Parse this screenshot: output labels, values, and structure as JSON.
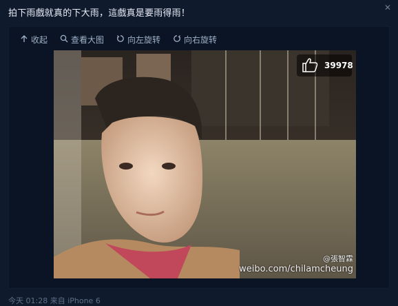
{
  "post": {
    "text": "拍下雨戲就真的下大雨，這戲真是要雨得雨！",
    "close_icon": "✕"
  },
  "toolbar": {
    "collapse": "收起",
    "view_large": "查看大图",
    "rotate_left": "向左旋转",
    "rotate_right": "向右旋转"
  },
  "photo": {
    "like_count": "39978",
    "watermark_handle": "@張智霖",
    "watermark_url": "weibo.com/chilamcheung"
  },
  "footer": {
    "meta": "今天 01:28 来自 iPhone 6"
  },
  "colors": {
    "background": "#0f1a2c",
    "accent": "#9fb0c8"
  }
}
